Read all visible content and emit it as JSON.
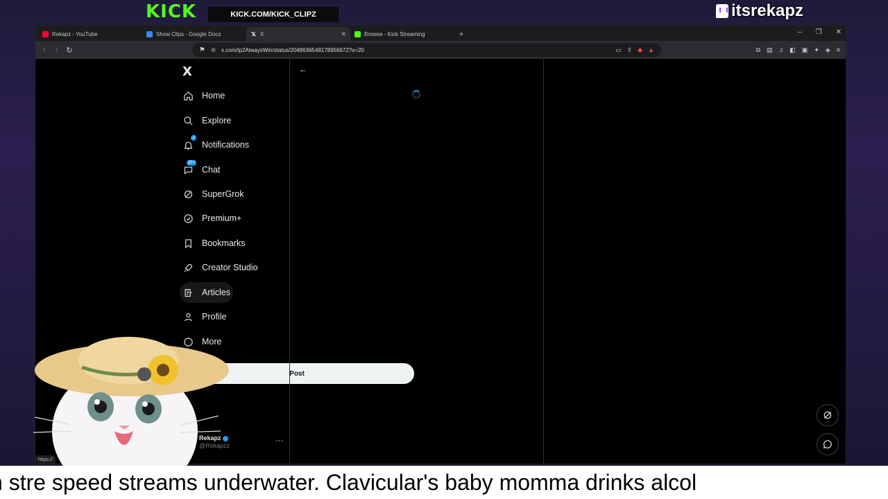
{
  "overlay": {
    "kick_logo": "KICK",
    "kick_banner": "KICK.COM/KICK_CLIPZ",
    "twitch_handle": "itsrekapz",
    "ticker_text": "n stre       speed streams underwater. Clavicular's baby momma drinks alcol"
  },
  "browser": {
    "tabs": [
      {
        "label": "Rekapz - YouTube",
        "icon": "youtube-icon",
        "color": "#ff0033"
      },
      {
        "label": "Show Clips - Google Docs",
        "icon": "docs-icon",
        "color": "#4285f4"
      },
      {
        "label": "X",
        "icon": "x-icon",
        "color": "#ffffff",
        "active": true
      },
      {
        "label": "Browse - Kick Streaming",
        "icon": "kick-icon",
        "color": "#53fc18"
      }
    ],
    "new_tab": "+",
    "url": "x.com/lp2AlwaysWin/status/2048636548178956672?s=20",
    "status_url": "https://"
  },
  "x": {
    "logo": "X",
    "nav": [
      {
        "label": "Home",
        "icon": "home-icon"
      },
      {
        "label": "Explore",
        "icon": "search-icon"
      },
      {
        "label": "Notifications",
        "icon": "bell-icon",
        "badge": "2"
      },
      {
        "label": "Chat",
        "icon": "chat-icon",
        "badge": "20+"
      },
      {
        "label": "SuperGrok",
        "icon": "grok-icon"
      },
      {
        "label": "Premium+",
        "icon": "premium-icon"
      },
      {
        "label": "Bookmarks",
        "icon": "bookmark-icon"
      },
      {
        "label": "Creator Studio",
        "icon": "rocket-icon"
      },
      {
        "label": "Articles",
        "icon": "articles-icon"
      },
      {
        "label": "Profile",
        "icon": "profile-icon"
      },
      {
        "label": "More",
        "icon": "more-icon"
      }
    ],
    "post_button": "Post",
    "account": {
      "name": "Rekapz",
      "handle": "@Rekapzz"
    },
    "more_dots": "···",
    "back_arrow": "←"
  }
}
